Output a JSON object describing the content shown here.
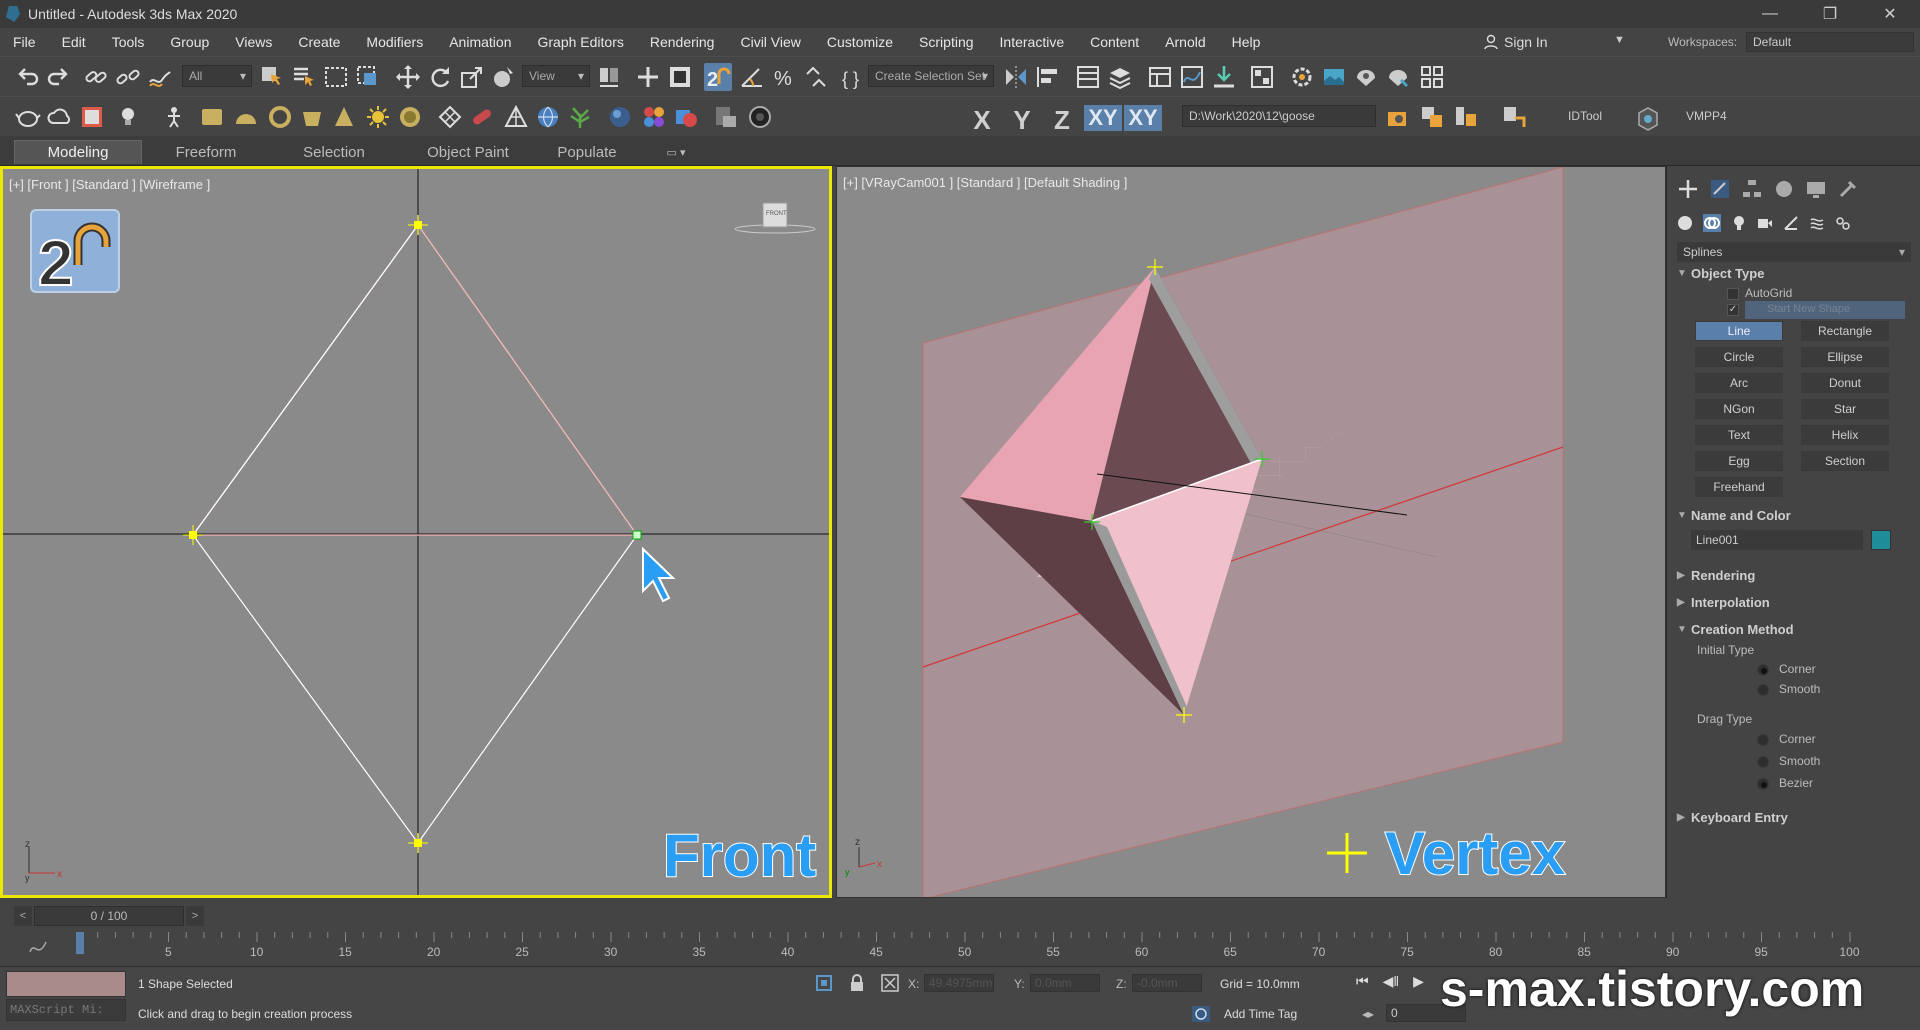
{
  "window": {
    "title": "Untitled - Autodesk 3ds Max 2020",
    "minimize": "—",
    "maximize": "❐",
    "close": "✕"
  },
  "menu": {
    "items": [
      "File",
      "Edit",
      "Tools",
      "Group",
      "Views",
      "Create",
      "Modifiers",
      "Animation",
      "Graph Editors",
      "Rendering",
      "Civil View",
      "Customize",
      "Scripting",
      "Interactive",
      "Content",
      "Arnold",
      "Help"
    ],
    "sign_in": "Sign In",
    "workspaces_label": "Workspaces:",
    "workspace_value": "Default"
  },
  "toolbar1": {
    "selection_filter": "All",
    "ref_coord": "View",
    "selection_set_placeholder": "Create Selection Set"
  },
  "toolbar2": {
    "axes": [
      "X",
      "Y",
      "Z",
      "XY",
      "XY"
    ],
    "project_path": "D:\\Work\\2020\\12\\goose",
    "idtool": "IDTool",
    "vmpp": "VMPP4"
  },
  "ribbon": {
    "tabs": [
      "Modeling",
      "Freeform",
      "Selection",
      "Object Paint",
      "Populate"
    ]
  },
  "viewports": {
    "left_label": "[+] [Front ] [Standard ] [Wireframe ]",
    "right_label": "[+] [VRayCam001 ] [Standard ] [Default Shading ]",
    "left_overlay": "Front",
    "right_overlay": "Vertex",
    "viewcube_label": "FRONT"
  },
  "command_panel": {
    "category": "Splines",
    "object_type": {
      "heading": "Object Type",
      "autogrid": "AutoGrid",
      "start_new_shape": "Start New Shape",
      "buttons": [
        "Line",
        "Rectangle",
        "Circle",
        "Ellipse",
        "Arc",
        "Donut",
        "NGon",
        "Star",
        "Text",
        "Helix",
        "Egg",
        "Section",
        "Freehand"
      ]
    },
    "name_color": {
      "heading": "Name and Color",
      "name": "Line001",
      "color": "#1f8c9a"
    },
    "rollouts": [
      "Rendering",
      "Interpolation"
    ],
    "creation_method": {
      "heading": "Creation Method",
      "initial_type": "Initial Type",
      "initial_options": [
        "Corner",
        "Smooth"
      ],
      "drag_type": "Drag Type",
      "drag_options": [
        "Corner",
        "Smooth",
        "Bezier"
      ]
    },
    "keyboard_entry": "Keyboard Entry"
  },
  "timeline": {
    "frame_display": "0 / 100",
    "ticks": [
      "5",
      "10",
      "15",
      "20",
      "25",
      "30",
      "35",
      "40",
      "45",
      "50",
      "55",
      "60",
      "65",
      "70",
      "75",
      "80",
      "85",
      "90",
      "95",
      "100"
    ]
  },
  "status": {
    "selected": "1 Shape Selected",
    "prompt": "Click and drag to begin creation process",
    "maxscript": "MAXScript Mi:",
    "x_label": "X:",
    "x_value": "49.4975mm",
    "y_label": "Y:",
    "y_value": "0.0mm",
    "z_label": "Z:",
    "z_value": "-0.0mm",
    "grid": "Grid = 10.0mm",
    "add_time_tag": "Add Time Tag",
    "frame_field": "0"
  },
  "watermark": "s-max.tistory.com",
  "colors": {
    "accent": "#5a7fa8",
    "viewport_bg": "#8a8a8a",
    "active_border": "#e8e800",
    "overlay_blue": "#2a9df4"
  }
}
